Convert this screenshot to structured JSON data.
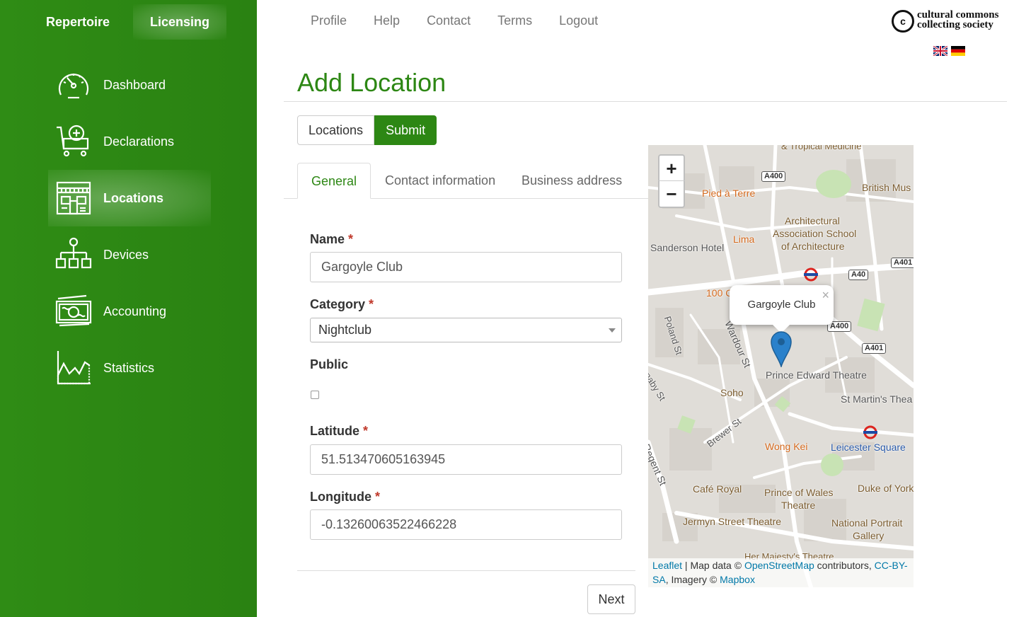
{
  "sidebar": {
    "top_tabs": [
      "Repertoire",
      "Licensing"
    ],
    "items": [
      {
        "label": "Dashboard",
        "icon": "speedometer-icon"
      },
      {
        "label": "Declarations",
        "icon": "cart-plus-icon"
      },
      {
        "label": "Locations",
        "icon": "storefront-icon",
        "active": true
      },
      {
        "label": "Devices",
        "icon": "hierarchy-icon"
      },
      {
        "label": "Accounting",
        "icon": "banknote-icon"
      },
      {
        "label": "Statistics",
        "icon": "area-chart-icon"
      }
    ]
  },
  "topnav": [
    "Profile",
    "Help",
    "Contact",
    "Terms",
    "Logout"
  ],
  "logo": {
    "mark": "c",
    "line1": "cultural commons",
    "line2": "collecting society",
    "languages": [
      "en-flag-icon",
      "de-flag-icon"
    ]
  },
  "page": {
    "title": "Add Location"
  },
  "buttons": {
    "locations": "Locations",
    "submit": "Submit",
    "next": "Next"
  },
  "form_tabs": [
    "General",
    "Contact information",
    "Business address"
  ],
  "form": {
    "name_label": "Name",
    "name_value": "Gargoyle Club",
    "category_label": "Category",
    "category_value": "Nightclub",
    "public_label": "Public",
    "public_checked": false,
    "latitude_label": "Latitude",
    "latitude_value": "51.513470605163945",
    "longitude_label": "Longitude",
    "longitude_value": "-0.13260063522466228",
    "required_mark": "*"
  },
  "map": {
    "zoom_in": "+",
    "zoom_out": "−",
    "popup_text": "Gargoyle Club",
    "popup_close": "×",
    "labels": {
      "tropical": "& Tropical Medicine",
      "pied": "Pied à Terre",
      "british": "British Mus",
      "aa1": "Architectural",
      "aa2": "Association School",
      "aa3": "of Architecture",
      "lima": "Lima",
      "sanderson": "Sanderson Hotel",
      "hundred": "100 C",
      "poland": "Poland St",
      "wardour": "Wardour St",
      "prince_edward": "Prince Edward Theatre",
      "stmartins": "St Martin's Thea",
      "carnaby": "rnaby St",
      "soho": "Soho",
      "brewer": "Brewer St",
      "wongkei": "Wong Kei",
      "leicester": "Leicester Square",
      "regent": "Regent St",
      "cafe": "Café Royal",
      "pow1": "Prince of Wales",
      "pow2": "Theatre",
      "duke": "Duke of York",
      "jermyn": "Jermyn Street Theatre",
      "npg1": "National Portrait",
      "npg2": "Gallery",
      "majesty": "Her Majesty's Theatre"
    },
    "roads": {
      "a400a": "A400",
      "a401a": "A401",
      "a40": "A40",
      "a400b": "A400",
      "a401b": "A401"
    },
    "attribution": {
      "leaflet": "Leaflet",
      "sep1": " | Map data © ",
      "osm": "OpenStreetMap",
      "contrib": " contributors, ",
      "ccbysa": "CC-BY-SA",
      "imagery": ", Imagery © ",
      "mapbox": "Mapbox"
    }
  },
  "colors": {
    "brand_green": "#2d8714",
    "required": "#c0392b",
    "link": "#0078a8",
    "marker": "#2a81cb"
  }
}
